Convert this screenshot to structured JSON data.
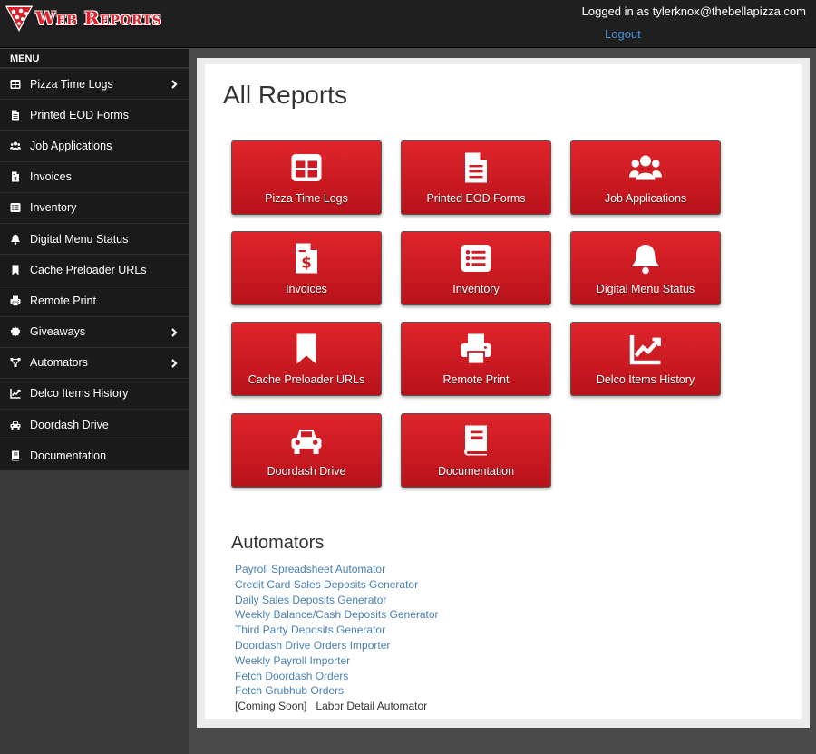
{
  "header": {
    "brand": "Web Reports",
    "logged_in": "Logged in as tylerknox@thebellapizza.com",
    "logout": "Logout"
  },
  "sidebar": {
    "menu_title": "MENU",
    "items": [
      {
        "label": "Pizza Time Logs",
        "icon": "table-icon",
        "chevron": true
      },
      {
        "label": "Printed EOD Forms",
        "icon": "file-icon",
        "chevron": false
      },
      {
        "label": "Job Applications",
        "icon": "users-icon",
        "chevron": false
      },
      {
        "label": "Invoices",
        "icon": "invoice-icon",
        "chevron": false
      },
      {
        "label": "Inventory",
        "icon": "list-icon",
        "chevron": false
      },
      {
        "label": "Digital Menu Status",
        "icon": "bell-icon",
        "chevron": false
      },
      {
        "label": "Cache Preloader URLs",
        "icon": "bookmark-icon",
        "chevron": false
      },
      {
        "label": "Remote Print",
        "icon": "printer-icon",
        "chevron": false
      },
      {
        "label": "Giveaways",
        "icon": "badge-icon",
        "chevron": true
      },
      {
        "label": "Automators",
        "icon": "network-icon",
        "chevron": true
      },
      {
        "label": "Delco Items History",
        "icon": "chart-icon",
        "chevron": false
      },
      {
        "label": "Doordash Drive",
        "icon": "car-icon",
        "chevron": false
      },
      {
        "label": "Documentation",
        "icon": "book-icon",
        "chevron": false
      }
    ]
  },
  "main": {
    "title": "All Reports",
    "tiles": [
      {
        "label": "Pizza Time Logs",
        "icon": "table-icon"
      },
      {
        "label": "Printed EOD Forms",
        "icon": "file-icon"
      },
      {
        "label": "Job Applications",
        "icon": "users-icon"
      },
      {
        "label": "Invoices",
        "icon": "invoice-icon"
      },
      {
        "label": "Inventory",
        "icon": "list-icon"
      },
      {
        "label": "Digital Menu Status",
        "icon": "bell-icon"
      },
      {
        "label": "Cache Preloader URLs",
        "icon": "bookmark-icon"
      },
      {
        "label": "Remote Print",
        "icon": "printer-icon"
      },
      {
        "label": "Delco Items History",
        "icon": "chart-icon"
      },
      {
        "label": "Doordash Drive",
        "icon": "car-icon"
      },
      {
        "label": "Documentation",
        "icon": "book-icon"
      }
    ],
    "automators_title": "Automators",
    "automators": [
      "Payroll Spreadsheet Automator",
      "Credit Card Sales Deposits Generator",
      "Daily Sales Deposits Generator",
      "Weekly Balance/Cash Deposits Generator",
      "Third Party Deposits Generator",
      "Doordash Drive Orders Importer",
      "Weekly Payroll Importer",
      "Fetch Doordash Orders",
      "Fetch Grubhub Orders"
    ],
    "coming_soon_tag": "[Coming Soon]",
    "coming_soon_item": "Labor Detail Automator"
  },
  "colors": {
    "accent": "#d81e26",
    "link": "#4a7fb5",
    "sidebar_bg": "#1a1a1a"
  }
}
